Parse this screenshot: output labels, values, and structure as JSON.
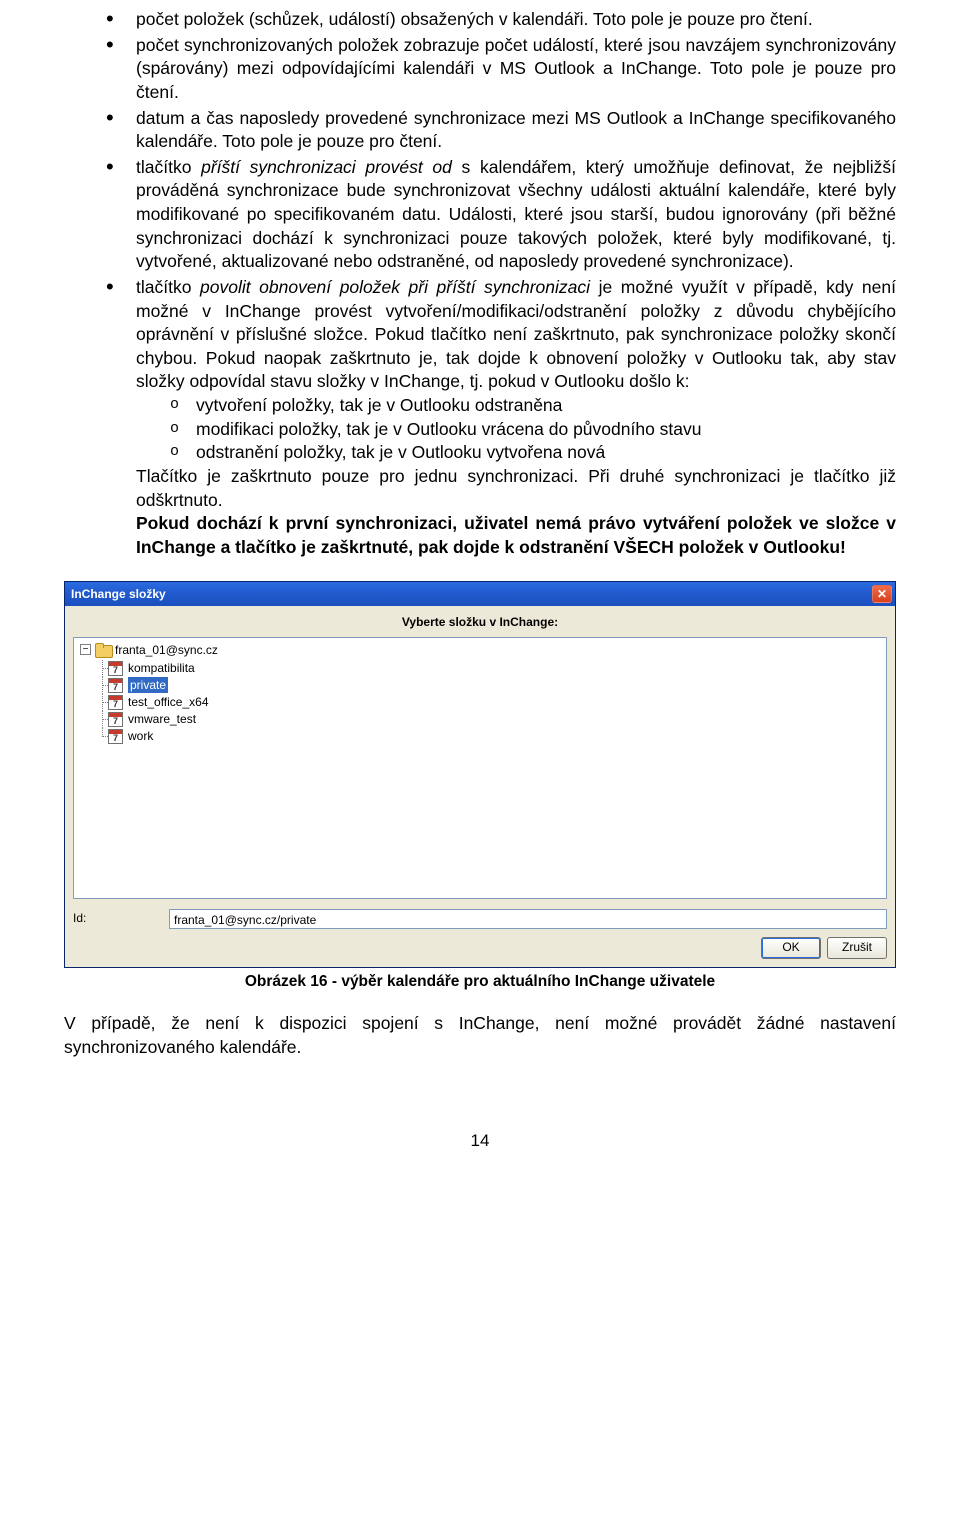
{
  "bullets": {
    "b1": "počet položek (schůzek, událostí) obsažených v kalendáři. Toto pole je pouze pro čtení.",
    "b2": "počet synchronizovaných položek zobrazuje počet událostí, které jsou navzájem synchronizovány (spárovány) mezi odpovídajícími kalendáři v MS Outlook a InChange. Toto pole je pouze pro čtení.",
    "b3": "datum a čas naposledy provedené synchronizace mezi MS Outlook a InChange specifikovaného kalendáře. Toto pole je pouze pro čtení.",
    "b4_pre": "tlačítko ",
    "b4_em": "příští synchronizaci provést od",
    "b4_post": " s kalendářem, který umožňuje definovat, že nejbližší prováděná synchronizace bude synchronizovat všechny události aktuální kalendáře, které byly modifikované po specifikovaném datu. Události, které jsou starší, budou ignorovány (při běžné synchronizaci dochází k synchronizaci pouze takových položek, které byly modifikované, tj. vytvořené, aktualizované nebo odstraněné, od naposledy provedené synchronizace).",
    "b5_pre": "tlačítko ",
    "b5_em": "povolit obnovení položek při příští synchronizaci",
    "b5_post": " je možné využít v případě, kdy není možné v InChange provést vytvoření/modifikaci/odstranění položky z důvodu chybějícího oprávnění v příslušné složce. Pokud tlačítko není zaškrtnuto, pak synchronizace položky skončí chybou. Pokud naopak zaškrtnuto je, tak dojde k obnovení položky v Outlooku tak, aby stav složky odpovídal stavu složky v InChange, tj. pokud v Outlooku došlo k:",
    "sub": [
      "vytvoření položky, tak je v Outlooku odstraněna",
      "modifikaci položky, tak je v Outlooku vrácena do původního stavu",
      "odstranění položky, tak je v Outlooku vytvořena nová"
    ],
    "b5_after": "Tlačítko je zaškrtnuto pouze pro jednu synchronizaci. Při druhé synchronizaci je tlačítko již odškrtnuto.",
    "b5_warn": "Pokud dochází k první synchronizaci, uživatel nemá právo vytváření položek ve složce v InChange a tlačítko je zaškrtnuté, pak dojde k odstranění VŠECH položek v Outlooku!"
  },
  "dialog": {
    "title": "InChange složky",
    "heading": "Vyberte složku v InChange:",
    "root": "franta_01@sync.cz",
    "items": [
      {
        "label": "kompatibilita",
        "selected": false
      },
      {
        "label": "private",
        "selected": true
      },
      {
        "label": "test_office_x64",
        "selected": false
      },
      {
        "label": "vmware_test",
        "selected": false
      },
      {
        "label": "work",
        "selected": false
      }
    ],
    "id_label": "Id:",
    "id_value": "franta_01@sync.cz/private",
    "ok": "OK",
    "cancel": "Zrušit"
  },
  "caption": "Obrázek 16 - výběr kalendáře pro aktuálního InChange uživatele",
  "closing": "V případě, že není k dispozici spojení s InChange, není možné provádět žádné nastavení synchronizovaného kalendáře.",
  "page": "14"
}
